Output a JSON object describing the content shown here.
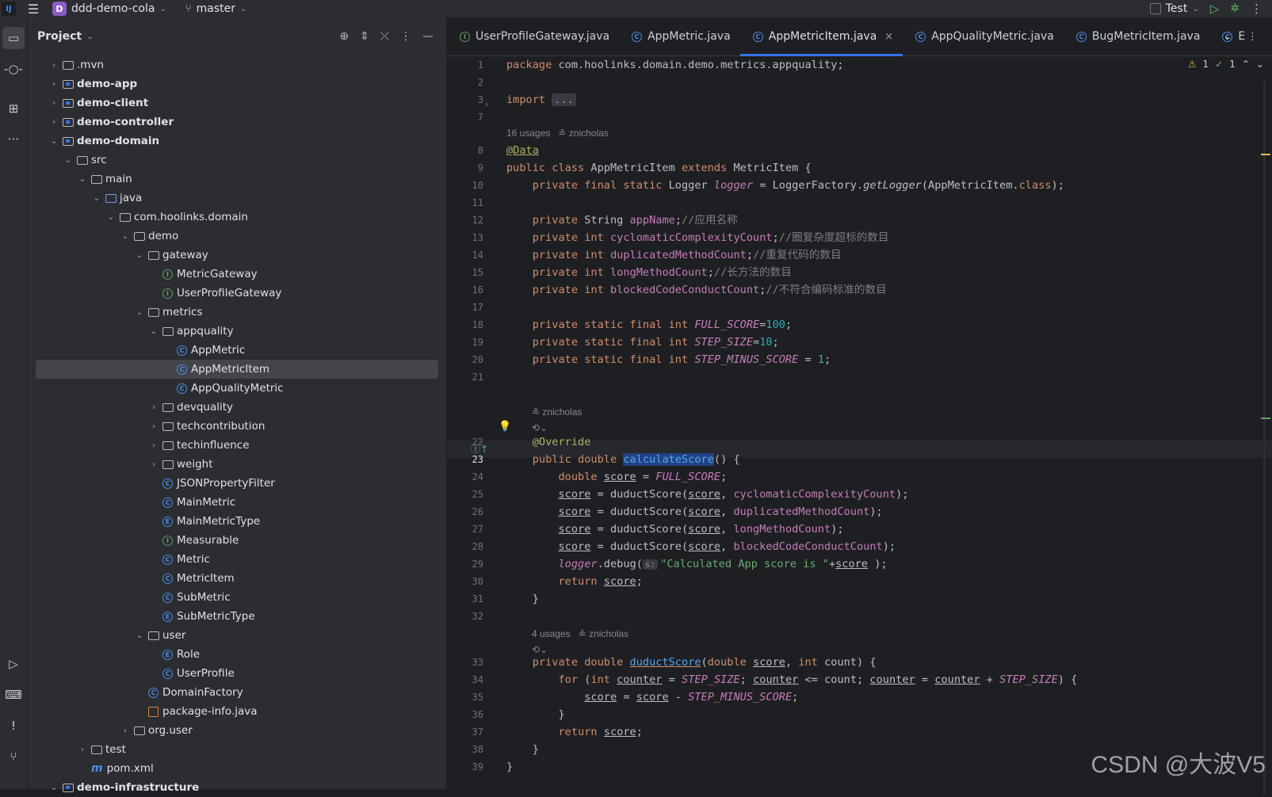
{
  "titlebar": {
    "project_initial": "D",
    "project_name": "ddd-demo-cola",
    "branch": "master",
    "run_config": "Test"
  },
  "project_panel": {
    "title": "Project",
    "tree": [
      {
        "label": ".mvn",
        "depth": 1,
        "expanded": false,
        "icon": "folder",
        "bold": false
      },
      {
        "label": "demo-app",
        "depth": 1,
        "expanded": false,
        "icon": "module",
        "bold": true
      },
      {
        "label": "demo-client",
        "depth": 1,
        "expanded": false,
        "icon": "module",
        "bold": true
      },
      {
        "label": "demo-controller",
        "depth": 1,
        "expanded": false,
        "icon": "module",
        "bold": true
      },
      {
        "label": "demo-domain",
        "depth": 1,
        "expanded": true,
        "icon": "module",
        "bold": true
      },
      {
        "label": "src",
        "depth": 2,
        "expanded": true,
        "icon": "folder",
        "bold": false
      },
      {
        "label": "main",
        "depth": 3,
        "expanded": true,
        "icon": "folder",
        "bold": false
      },
      {
        "label": "java",
        "depth": 4,
        "expanded": true,
        "icon": "source",
        "bold": false
      },
      {
        "label": "com.hoolinks.domain",
        "depth": 5,
        "expanded": true,
        "icon": "package",
        "bold": false
      },
      {
        "label": "demo",
        "depth": 6,
        "expanded": true,
        "icon": "package",
        "bold": false
      },
      {
        "label": "gateway",
        "depth": 7,
        "expanded": true,
        "icon": "package",
        "bold": false
      },
      {
        "label": "MetricGateway",
        "depth": 8,
        "icon": "interface",
        "bold": false
      },
      {
        "label": "UserProfileGateway",
        "depth": 8,
        "icon": "interface",
        "bold": false
      },
      {
        "label": "metrics",
        "depth": 7,
        "expanded": true,
        "icon": "package",
        "bold": false
      },
      {
        "label": "appquality",
        "depth": 8,
        "expanded": true,
        "icon": "package",
        "bold": false
      },
      {
        "label": "AppMetric",
        "depth": 9,
        "icon": "class",
        "bold": false
      },
      {
        "label": "AppMetricItem",
        "depth": 9,
        "icon": "class",
        "bold": false,
        "selected": true
      },
      {
        "label": "AppQualityMetric",
        "depth": 9,
        "icon": "class",
        "bold": false
      },
      {
        "label": "devquality",
        "depth": 8,
        "expanded": false,
        "icon": "package",
        "bold": false
      },
      {
        "label": "techcontribution",
        "depth": 8,
        "expanded": false,
        "icon": "package",
        "bold": false
      },
      {
        "label": "techinfluence",
        "depth": 8,
        "expanded": false,
        "icon": "package",
        "bold": false
      },
      {
        "label": "weight",
        "depth": 8,
        "expanded": false,
        "icon": "package",
        "bold": false
      },
      {
        "label": "JSONPropertyFilter",
        "depth": 8,
        "icon": "class",
        "bold": false
      },
      {
        "label": "MainMetric",
        "depth": 8,
        "icon": "class",
        "bold": false
      },
      {
        "label": "MainMetricType",
        "depth": 8,
        "icon": "enum",
        "bold": false
      },
      {
        "label": "Measurable",
        "depth": 8,
        "icon": "interface",
        "bold": false
      },
      {
        "label": "Metric",
        "depth": 8,
        "icon": "class",
        "bold": false
      },
      {
        "label": "MetricItem",
        "depth": 8,
        "icon": "class",
        "bold": false
      },
      {
        "label": "SubMetric",
        "depth": 8,
        "icon": "class",
        "bold": false
      },
      {
        "label": "SubMetricType",
        "depth": 8,
        "icon": "enum",
        "bold": false
      },
      {
        "label": "user",
        "depth": 7,
        "expanded": true,
        "icon": "package",
        "bold": false
      },
      {
        "label": "Role",
        "depth": 8,
        "icon": "enum",
        "bold": false
      },
      {
        "label": "UserProfile",
        "depth": 8,
        "icon": "class",
        "bold": false
      },
      {
        "label": "DomainFactory",
        "depth": 7,
        "icon": "class",
        "bold": false
      },
      {
        "label": "package-info.java",
        "depth": 7,
        "icon": "pkginfo",
        "bold": false
      },
      {
        "label": "org.user",
        "depth": 6,
        "expanded": false,
        "icon": "package",
        "bold": false
      },
      {
        "label": "test",
        "depth": 3,
        "expanded": false,
        "icon": "folder",
        "bold": false
      },
      {
        "label": "pom.xml",
        "depth": 3,
        "icon": "maven",
        "bold": false
      },
      {
        "label": "demo-infrastructure",
        "depth": 1,
        "expanded": true,
        "icon": "module",
        "bold": true
      }
    ]
  },
  "editor": {
    "tabs": [
      {
        "label": "UserProfileGateway.java",
        "icon": "interface",
        "active": false
      },
      {
        "label": "AppMetric.java",
        "icon": "class",
        "active": false
      },
      {
        "label": "AppMetricItem.java",
        "icon": "class",
        "active": true
      },
      {
        "label": "AppQualityMetric.java",
        "icon": "class",
        "active": false
      },
      {
        "label": "BugMetricItem.java",
        "icon": "class",
        "active": false
      },
      {
        "label": "E",
        "icon": "class",
        "active": false
      }
    ],
    "inspections": {
      "warnings": "1",
      "ok": "1"
    },
    "hints": {
      "h1": "16 usages   ≗ znicholas",
      "h2": "≗ znicholas",
      "h3": "4 usages   ≗ znicholas"
    },
    "line_numbers": [
      "1",
      "2",
      "3",
      "7",
      "8",
      "9",
      "10",
      "11",
      "12",
      "13",
      "14",
      "15",
      "16",
      "17",
      "18",
      "19",
      "20",
      "21",
      "22",
      "23",
      "24",
      "25",
      "26",
      "27",
      "28",
      "29",
      "30",
      "31",
      "32",
      "33",
      "34",
      "35",
      "36",
      "37",
      "38",
      "39"
    ],
    "comments": {
      "app_name": "//应用名称",
      "cyclomatic": "//圈复杂度超标的数目",
      "duplicated": "//重复代码的数目",
      "long_method": "//长方法的数目",
      "blocked": "//不符合编码标准的数目"
    },
    "strings": {
      "log_msg": "\"Calculated App score is \""
    }
  },
  "watermark": "CSDN @大波V5"
}
